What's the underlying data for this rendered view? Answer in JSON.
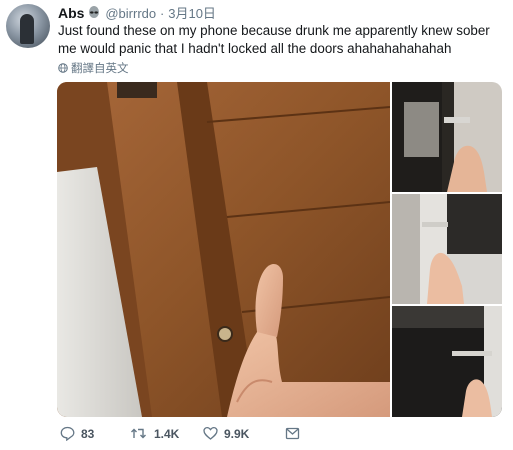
{
  "tweet": {
    "display_name": "Abs",
    "handle": "@birrrdo",
    "separator": "·",
    "date": "3月10日",
    "text": "Just found these on my phone because drunk me apparently knew sober me would panic that I hadn't locked all the doors ahahahahahahah",
    "translate_label": "翻譯自英文"
  },
  "actions": {
    "replies": "83",
    "retweets": "1.4K",
    "likes": "9.9K"
  },
  "icons": {
    "emoji": "alien-icon",
    "translate": "globe-icon",
    "reply": "reply-icon",
    "retweet": "retweet-icon",
    "like": "heart-icon",
    "message": "message-icon"
  },
  "colors": {
    "text": "#14171a",
    "muted": "#657786"
  }
}
